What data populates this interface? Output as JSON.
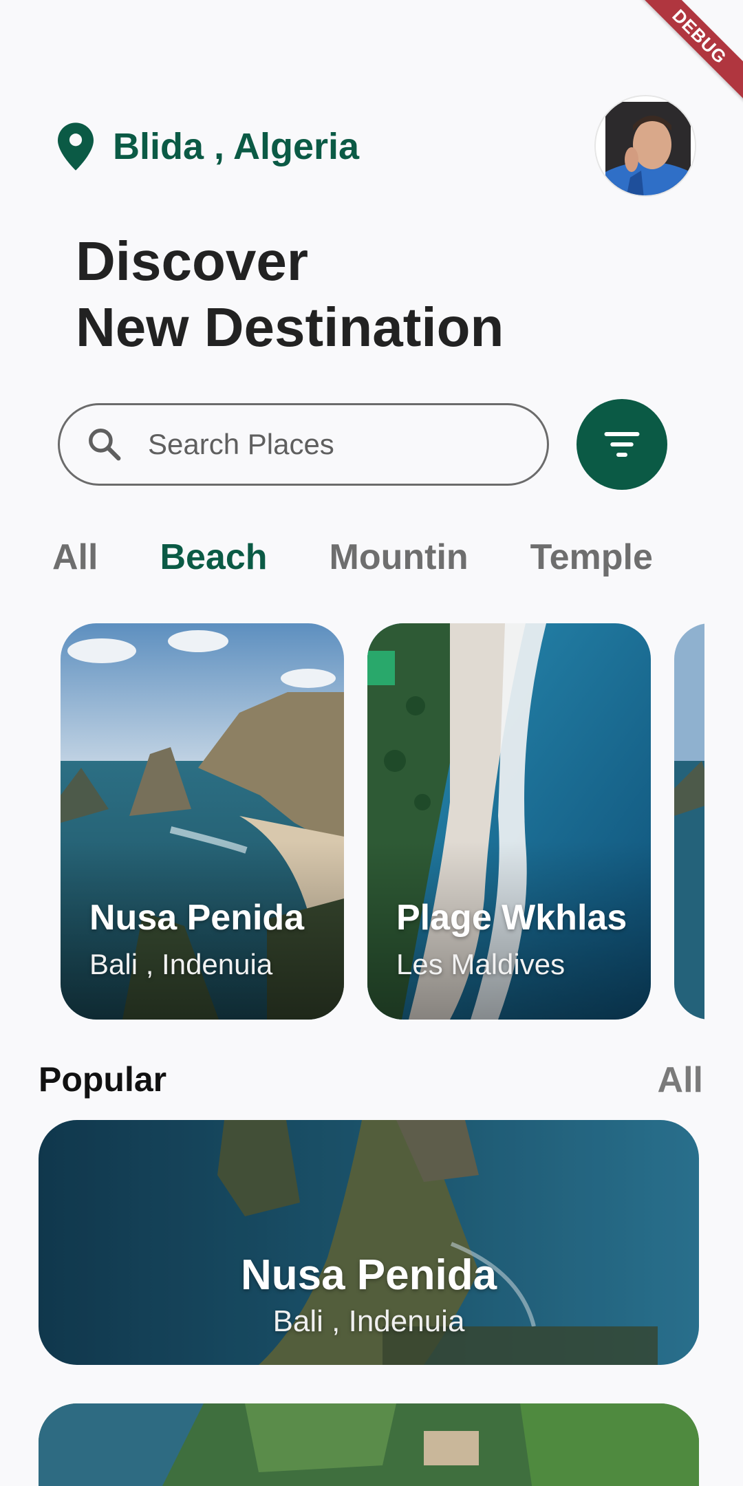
{
  "debug_banner": "DEBUG",
  "header": {
    "location": "Blida , Algeria",
    "location_icon": "location-pin-icon"
  },
  "headline": {
    "line1": "Discover",
    "line2": "New Destination"
  },
  "search": {
    "placeholder": "Search Places",
    "icon": "search-icon"
  },
  "filter": {
    "icon": "filter-icon"
  },
  "categories": {
    "items": [
      "All",
      "Beach",
      "Mountin",
      "Temple"
    ],
    "selected": "Beach"
  },
  "featured": [
    {
      "title": "Nusa Penida",
      "subtitle": "Bali , Indenuia"
    },
    {
      "title": "Plage Wkhlas",
      "subtitle": "Les Maldives"
    }
  ],
  "popular": {
    "title": "Popular",
    "see_all": "All",
    "items": [
      {
        "title": "Nusa Penida",
        "subtitle": "Bali , Indenuia"
      }
    ]
  },
  "colors": {
    "accent": "#0b5a45",
    "background": "#f9f9fb"
  }
}
